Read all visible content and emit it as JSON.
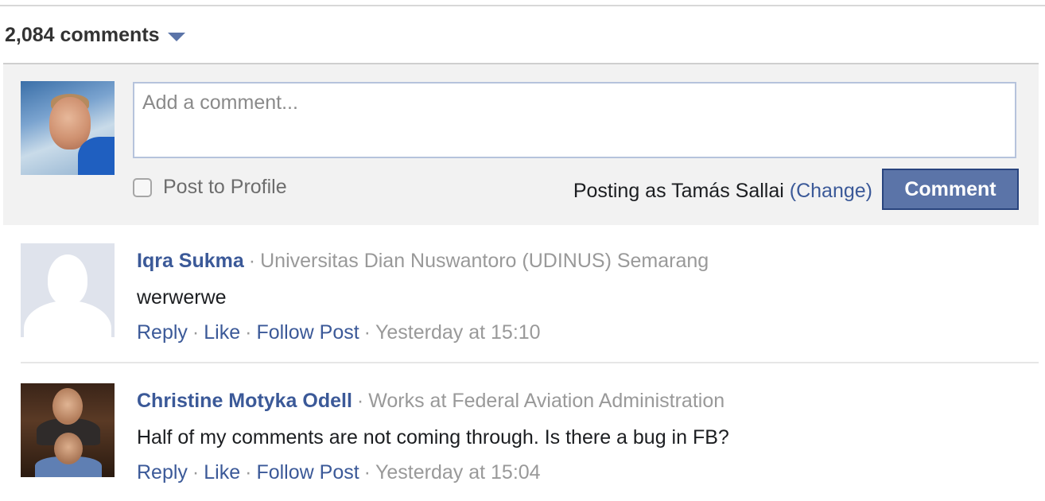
{
  "header": {
    "count_label": "2,084 comments",
    "dropdown_icon": "caret-down-icon"
  },
  "composer": {
    "placeholder": "Add a comment...",
    "value": "",
    "post_to_profile_label": "Post to Profile",
    "post_to_profile_checked": false,
    "posting_as_prefix": "Posting as Tamás Sallai",
    "change_label": "(Change)",
    "submit_label": "Comment"
  },
  "comments": [
    {
      "author": "Iqra Sukma",
      "org": "Universitas Dian Nuswantoro (UDINUS) Semarang",
      "text": "werwerwe",
      "actions": [
        "Reply",
        "Like",
        "Follow Post"
      ],
      "time": "Yesterday at 15:10",
      "avatar": "default-silhouette"
    },
    {
      "author": "Christine Motyka Odell",
      "works_at_prefix": "Works at",
      "org": "Federal Aviation Administration",
      "text": "Half of my comments are not coming through. Is there a bug in FB?",
      "actions": [
        "Reply",
        "Like",
        "Follow Post"
      ],
      "time": "Yesterday at 15:04",
      "avatar": "photo"
    }
  ],
  "colors": {
    "link": "#3b5998",
    "meta": "#999999",
    "button_bg": "#5b74a8",
    "compose_bg": "#f2f2f2"
  }
}
